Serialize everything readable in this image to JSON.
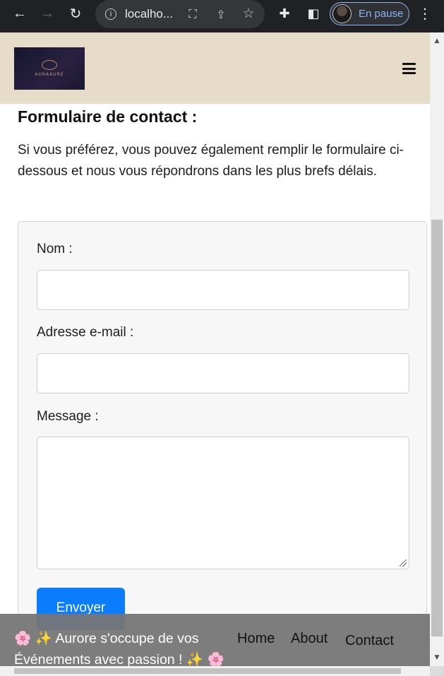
{
  "browser": {
    "back_icon": "arrow-left-icon",
    "forward_icon": "arrow-right-icon",
    "reload_icon": "reload-icon",
    "url": "localho...",
    "profile_label": "En pause",
    "glyphs": {
      "back": "←",
      "forward": "→",
      "reload": "↻",
      "info": "i",
      "translate": "⛶",
      "share": "⇪",
      "star": "☆",
      "extensions": "✚",
      "sidepanel": "◧",
      "menu": "⋮"
    }
  },
  "header": {
    "logo_text": "AURAAURE",
    "menu_icon": "hamburger-menu-icon",
    "background": "#e6dcc9"
  },
  "contact": {
    "title": "Formulaire de contact :",
    "intro": "Si vous préférez, vous pouvez également remplir le formulaire ci-dessous et nous vous répondrons dans les plus brefs délais.",
    "form": {
      "name_label": "Nom :",
      "name_value": "",
      "email_label": "Adresse e-mail :",
      "email_value": "",
      "message_label": "Message :",
      "message_value": "",
      "submit_label": "Envoyer",
      "submit_color": "#0b7dff"
    }
  },
  "footer": {
    "tagline_line1": "🌸 ✨ Aurore s'occupe de vos",
    "tagline_line2": "Événements avec passion ! ✨ 🌸",
    "nav": {
      "home": "Home",
      "about": "About",
      "contact": "Contact"
    }
  },
  "scrollbar": {
    "up": "▲",
    "down": "▼"
  }
}
